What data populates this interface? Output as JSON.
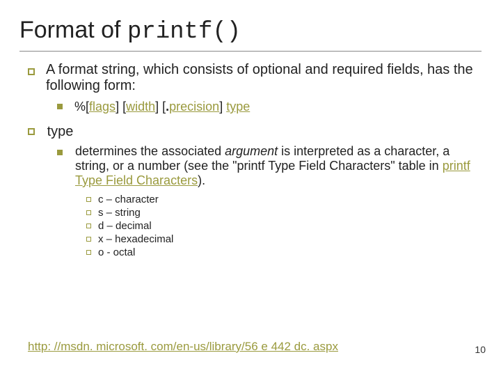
{
  "title_prefix": "Format of ",
  "title_code": "printf()",
  "bullet1": "A format string, which consists of optional and required fields, has the following form:",
  "fmt": {
    "pct": "%[",
    "flags": "flags",
    "b1": "] [",
    "width": "width",
    "b2": "] [",
    "dot": ".",
    "precision": "precision",
    "b3": "] ",
    "type": "type"
  },
  "bullet2": "type",
  "det1": "determines the associated ",
  "det_arg": "argument",
  "det2": " is interpreted as a character, a string, or a number (see the \"printf Type Field Characters\" table in ",
  "det_link": "printf Type Field Characters",
  "det3": ").",
  "types": [
    "c – character",
    "s – string",
    "d – decimal",
    "x – hexadecimal",
    "o - octal"
  ],
  "footer_url": "http: //msdn. microsoft. com/en-us/library/56 e 442 dc. aspx",
  "page": "10"
}
